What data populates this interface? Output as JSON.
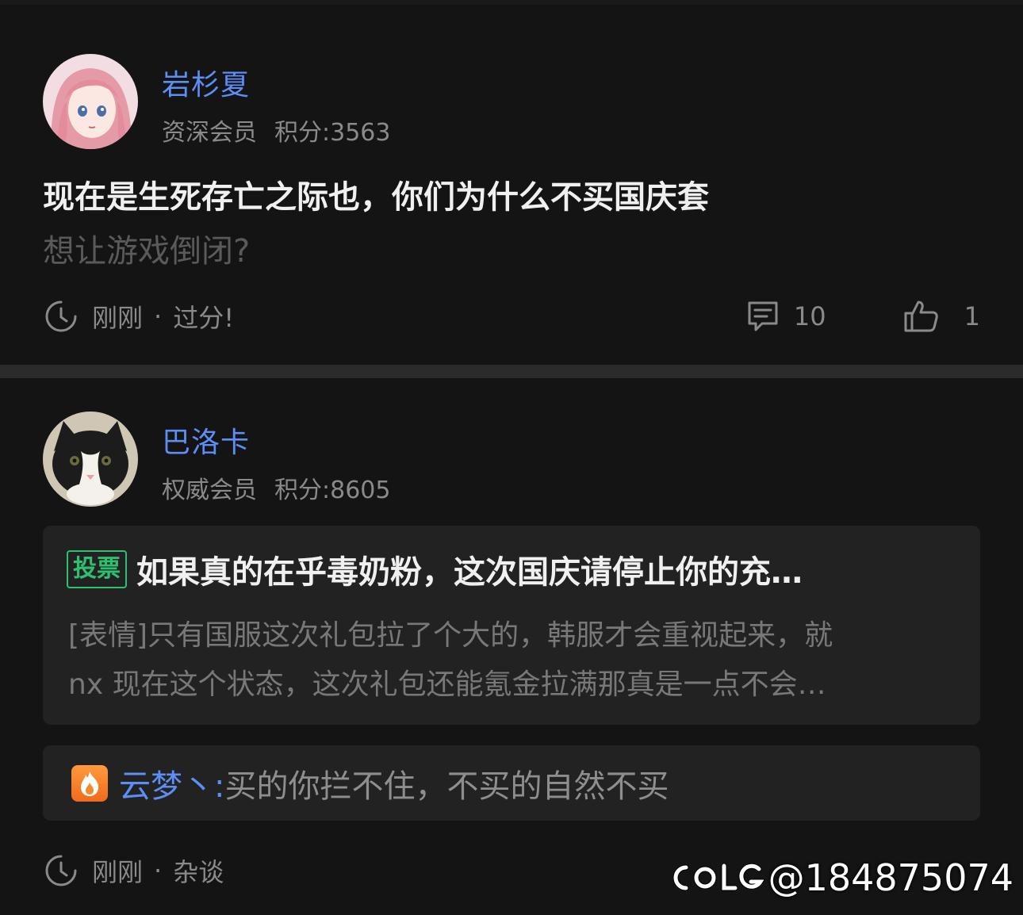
{
  "posts": [
    {
      "username": "岩杉夏",
      "rank": "资深会员",
      "points": "积分:3563",
      "title": "现在是生死存亡之际也，你们为什么不买国庆套",
      "subtitle": "想让游戏倒闭?",
      "time": "刚刚",
      "dot": "·",
      "category": "过分!",
      "comments": "10",
      "likes": "1"
    },
    {
      "username": "巴洛卡",
      "rank": "权威会员",
      "points": "积分:8605",
      "vote": {
        "badge": "投票",
        "title": "如果真的在乎毒奶粉，这次国庆请停止你的充…",
        "body_lines": [
          "[表情]只有国服这次礼包拉了个大的，韩服才会重视起来，就",
          "nx 现在这个状态，这次礼包还能氪金拉满那真是一点不会…"
        ]
      },
      "reply": {
        "user": "云梦丶:",
        "text": "买的你拦不住，不买的自然不买"
      },
      "time": "刚刚",
      "dot": "·",
      "category": "杂谈"
    }
  ],
  "watermark": {
    "logo": "COLG",
    "handle": "@184875074"
  },
  "icons": {
    "clock": "clock-icon",
    "comment": "comment-icon",
    "like": "thumbs-up-icon",
    "fire": "fire-icon"
  },
  "colors": {
    "background": "#121212",
    "username": "#5d8ef5",
    "vote_badge": "#2fbf71",
    "fire_badge": "#f58a2c"
  }
}
